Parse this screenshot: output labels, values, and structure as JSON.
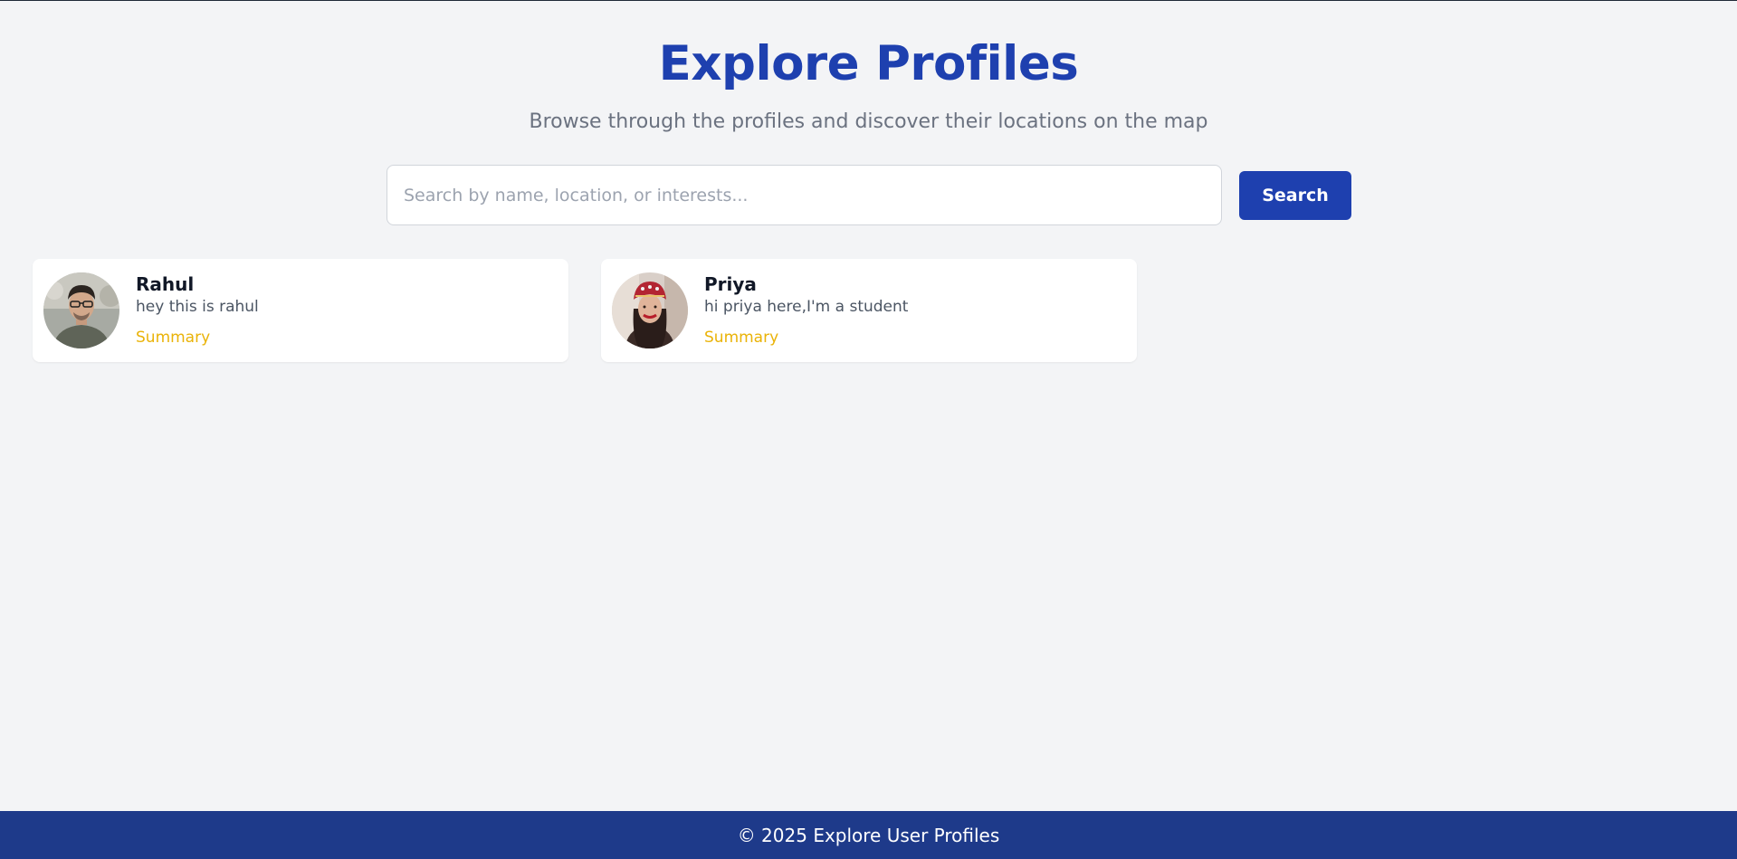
{
  "header": {
    "title": "Explore Profiles",
    "subtitle": "Browse through the profiles and discover their locations on the map"
  },
  "search": {
    "placeholder": "Search by name, location, or interests...",
    "value": "",
    "button_label": "Search"
  },
  "profiles": [
    {
      "name": "Rahul",
      "bio": "hey this is rahul",
      "link_label": "Summary",
      "avatar_icon": "user-photo-icon"
    },
    {
      "name": "Priya",
      "bio": "hi priya here,I'm a student",
      "link_label": "Summary",
      "avatar_icon": "user-photo-icon"
    }
  ],
  "footer": {
    "text": "© 2025 Explore User Profiles"
  },
  "colors": {
    "accent": "#1e40af",
    "footer_bg": "#1e3a8a",
    "link": "#eab308",
    "page_bg": "#f3f4f6"
  }
}
